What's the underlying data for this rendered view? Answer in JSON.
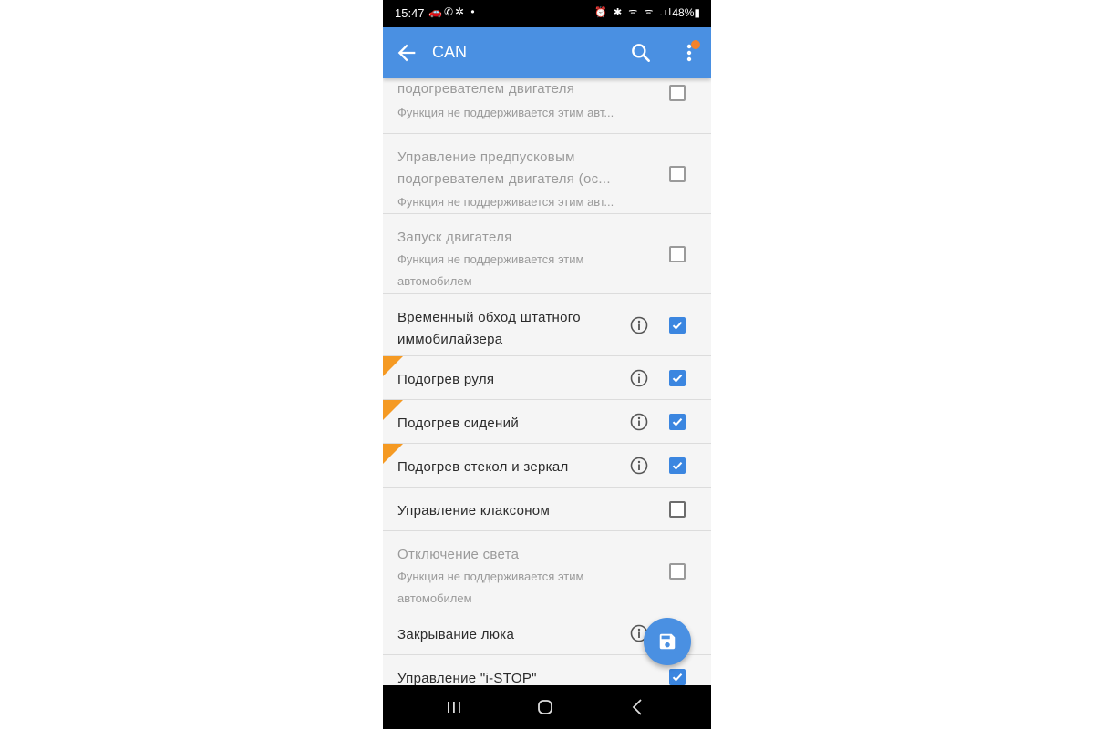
{
  "statusbar": {
    "time": "15:47",
    "left_icons": "🚗✆✲ •",
    "right_icons": "⏰ ✱ ᯤ ᯤ .ıl",
    "battery": "48%▮"
  },
  "appbar": {
    "title": "CAN",
    "back_icon": "arrow-left-icon",
    "search_icon": "search-icon",
    "menu_icon": "more-vert-icon",
    "badge_color": "#f5822a"
  },
  "colors": {
    "appbar": "#4a90e2",
    "checked": "#3b86e0",
    "warning_corner": "#f59a23"
  },
  "items": [
    {
      "title": "подогревателем двигателя",
      "subtitle": "Функция не поддерживается этим авт...",
      "checked": false,
      "disabled": true
    },
    {
      "title": "Управление предпусковым подогревателем двигателя (ос...",
      "subtitle": "Функция не поддерживается этим авт...",
      "checked": false,
      "disabled": true
    },
    {
      "title": "Запуск двигателя",
      "subtitle": "Функция не поддерживается этим автомобилем",
      "checked": false,
      "disabled": true
    },
    {
      "title": "Временный обход штатного иммобилайзера",
      "checked": true,
      "info": true
    },
    {
      "title": "Подогрев руля",
      "checked": true,
      "info": true,
      "corner": true
    },
    {
      "title": "Подогрев сидений",
      "checked": true,
      "info": true,
      "corner": true
    },
    {
      "title": "Подогрев стекол и зеркал",
      "checked": true,
      "info": true,
      "corner": true
    },
    {
      "title": "Управление клаксоном",
      "checked": false
    },
    {
      "title": "Отключение света",
      "subtitle": "Функция не поддерживается этим автомобилем",
      "checked": false,
      "disabled": true
    },
    {
      "title": "Закрывание люка",
      "info": true
    },
    {
      "title": "Управление \"i-STOP\"",
      "checked": true
    }
  ],
  "fab": {
    "icon": "save-icon"
  },
  "navbar": {
    "recents_icon": "recents-icon",
    "home_icon": "home-icon",
    "back_icon": "nav-back-icon"
  }
}
